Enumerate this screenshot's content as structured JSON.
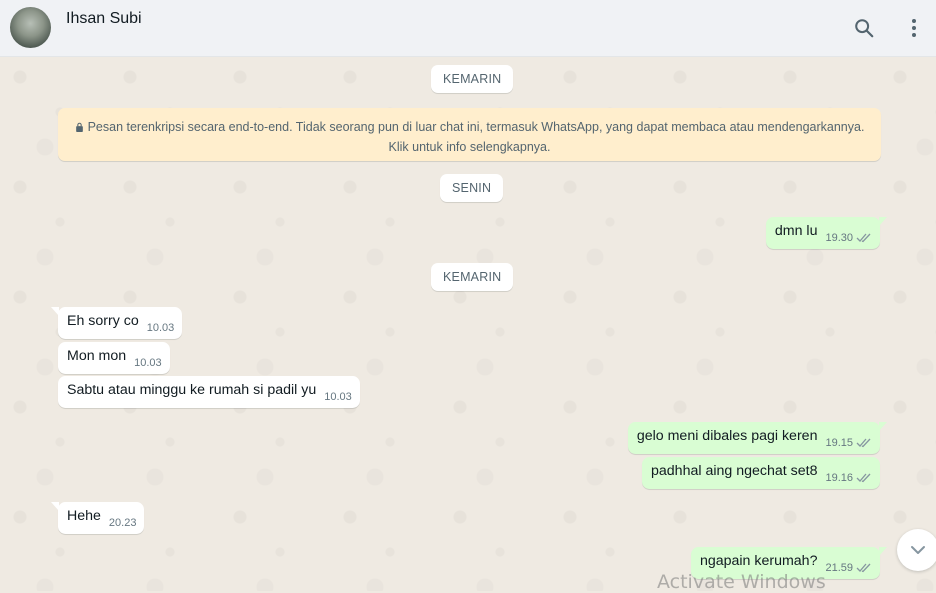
{
  "header": {
    "contact_name": "Ihsan Subi",
    "icons": [
      "search-icon",
      "menu-icon"
    ]
  },
  "chat": {
    "date_chip_1": "KEMARIN",
    "encryption_notice": {
      "line1": "Pesan terenkripsi secara end-to-end. Tidak seorang pun di luar chat ini, termasuk WhatsApp, yang dapat membaca atau mendengarkannya.",
      "line2": "Klik untuk info selengkapnya."
    },
    "date_chip_2": "SENIN",
    "date_chip_3": "KEMARIN",
    "messages": [
      {
        "dir": "out",
        "text": "dmn lu",
        "time": "19.30",
        "status": "read"
      },
      {
        "dir": "in",
        "text": "Eh sorry co",
        "time": "10.03"
      },
      {
        "dir": "in",
        "text": "Mon mon",
        "time": "10.03"
      },
      {
        "dir": "in",
        "text": "Sabtu atau minggu ke rumah si padil yu",
        "time": "10.03"
      },
      {
        "dir": "out",
        "text": "gelo meni dibales pagi keren",
        "time": "19.15",
        "status": "read"
      },
      {
        "dir": "out",
        "text": "padhhal aing ngechat set8",
        "time": "19.16",
        "status": "read"
      },
      {
        "dir": "in",
        "text": "Hehe",
        "time": "20.23"
      },
      {
        "dir": "out",
        "text": "ngapain kerumah?",
        "time": "21.59",
        "status": "read"
      }
    ]
  },
  "overlay": {
    "watermark": "Activate Windows"
  },
  "colors": {
    "header_bg": "#f0f2f5",
    "chat_bg": "#efeae2",
    "incoming_bubble": "#ffffff",
    "outgoing_bubble": "#d9fdd3",
    "notice_bg": "#ffeecd",
    "ticks": "#8696a0"
  }
}
